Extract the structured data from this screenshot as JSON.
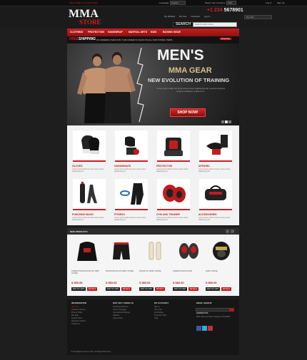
{
  "topbar": {
    "welcome": "WELCOME TO OUR STORE!",
    "language_label": "Language:",
    "language_value": "English",
    "currency_label": "Select Your Currency:",
    "currency_value": "USD",
    "login": "Log In",
    "register": "Sign Up"
  },
  "header": {
    "logo_main": "MMA",
    "logo_sub": "STORE",
    "phone_prefix": "+1 234",
    "phone_number": "5678901",
    "links": [
      "My Wishlist",
      "My Cart",
      "Checkout",
      "Log In"
    ],
    "cart": "My Cart",
    "search_label": "SEARCH",
    "search_placeholder": "Search entire store..."
  },
  "nav": {
    "items": [
      "CLOTHING",
      "PROTECTION",
      "HANDWRAP",
      "MARTIAL ARTS",
      "KIDS",
      "BOXING GEAR"
    ]
  },
  "shipping": {
    "free": "FREE",
    "shipping": "SHIPPING",
    "text": "ON ORDERS OVER $ 99. THIS OFFER IS VALID ON ALL OUR STORE ITEMS.",
    "badge": "Shop Now"
  },
  "banner": {
    "line1": "MEN'S",
    "line2": "MMA GEAR",
    "line3": "NEW EVOLUTION OF TRAINING",
    "text": "Lorem ipsum dolor sit amet conse ctetur adipisicing elit, sed do eiusmod tempor incididunt ut labore et.",
    "button": "SHOP NOW!"
  },
  "categories": [
    {
      "name": "GLOVES",
      "desc": "Lorem ipsum dolor sit amet conse ctetur adipisicing elit"
    },
    {
      "name": "HANDWRAPS",
      "desc": "Lorem ipsum dolor sit amet conse ctetur adipisicing elit"
    },
    {
      "name": "PROTECTIVE",
      "desc": "Lorem ipsum dolor sit amet conse ctetur adipisicing elit"
    },
    {
      "name": "APPAREL",
      "desc": "Lorem ipsum dolor sit amet conse ctetur adipisicing elit"
    },
    {
      "name": "PUNCHING BAGS",
      "desc": "Lorem ipsum dolor sit amet conse ctetur adipisicing elit"
    },
    {
      "name": "FITNESS",
      "desc": "Lorem ipsum dolor sit amet conse ctetur adipisicing elit"
    },
    {
      "name": "GYM AND TRAINER",
      "desc": "Lorem ipsum dolor sit amet conse ctetur adipisicing elit"
    },
    {
      "name": "ACCESSORIES",
      "desc": "Lorem ipsum dolor sit amet conse ctetur adipisicing elit"
    }
  ],
  "new_products": {
    "title": "NEW PRODUCTS",
    "items": [
      {
        "name": "LOREM IPSUM DOLOR SIT AMET CONSE",
        "price": "$ 589.96"
      },
      {
        "name": "IPSUM DOLOR SIT AMET CONSE",
        "price": "$ 589.96"
      },
      {
        "name": "DOLOR SIT AMET CONSE",
        "price": "$ 589.96"
      },
      {
        "name": "LOREM IPSUM DOLOR",
        "price": "$ 589.96"
      },
      {
        "name": "AMET CONSE",
        "price": "$ 589.96"
      }
    ],
    "add_to_cart": "ADD TO CART",
    "details": "DETAILS"
  },
  "footer": {
    "col1_title": "INFORMATION",
    "col1_links": [
      "About Us",
      "Customer Service",
      "Privacy Policy",
      "Site Map",
      "Search Terms",
      "Advanced Search",
      "Contact Us"
    ],
    "col2_title": "WHY BUY FROM US",
    "col2_links": [
      "Shipping & Returns",
      "Secure Shopping",
      "International Shipping",
      "Affiliates",
      "Group Sales"
    ],
    "col3_title": "MY ACCOUNT",
    "col3_links": [
      "Sign In",
      "View Cart",
      "My Wishlist",
      "Track My Order",
      "Help"
    ],
    "col4_title": "EMAIL SIGNUP",
    "contacts_title": "CONTACTS",
    "contacts_text": "8901 Marmora Road, Glasgow, D04 89GR.",
    "copyright": "© 2013 Magento Demo Store. All Rights Reserved."
  },
  "colors": {
    "accent": "#c41f1f",
    "dark": "#1b1b1b",
    "gold": "#d4c28c"
  }
}
